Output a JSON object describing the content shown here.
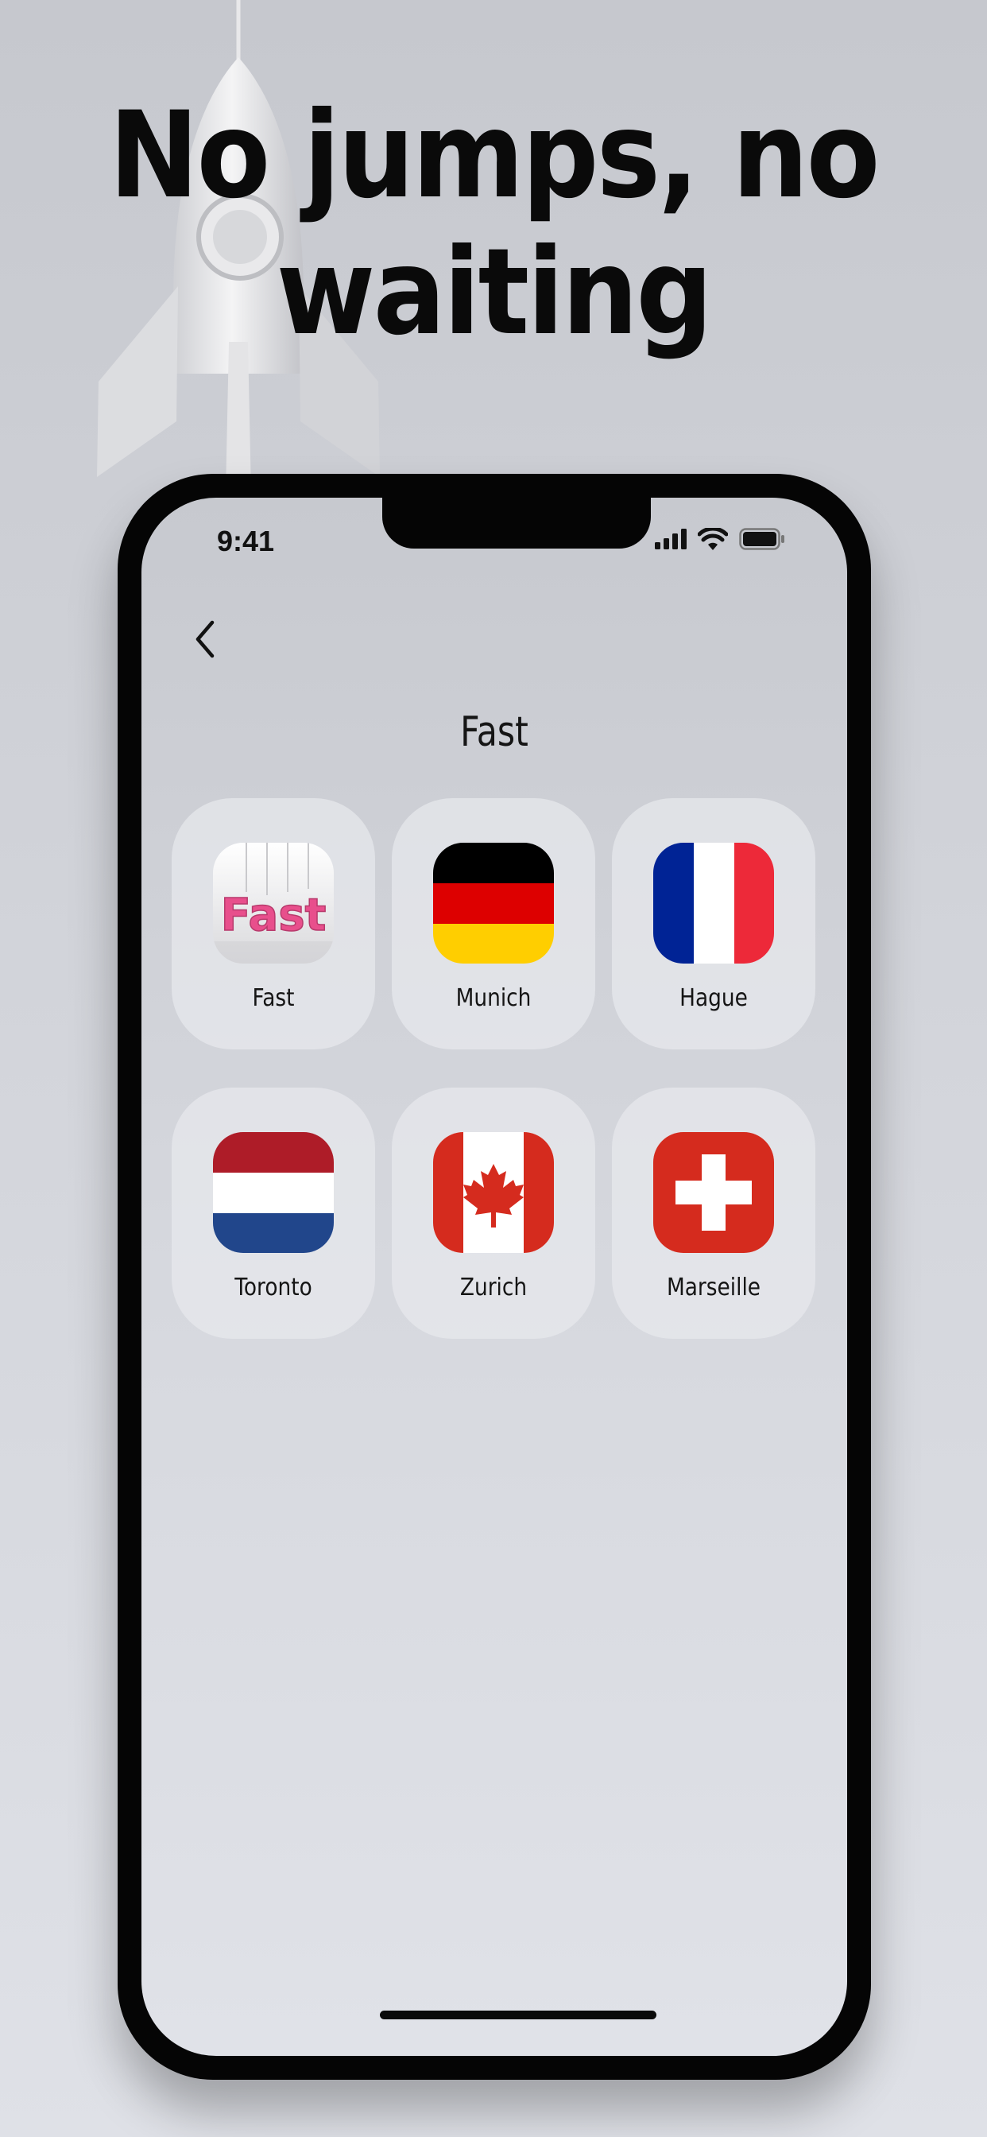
{
  "headline": {
    "line1": "No jumps, no",
    "line2": "waiting"
  },
  "status_bar": {
    "time": "9:41",
    "icons": [
      "signal-icon",
      "wifi-icon",
      "battery-icon"
    ]
  },
  "nav": {
    "back_icon": "chevron-left-icon"
  },
  "page": {
    "title": "Fast"
  },
  "locations": [
    {
      "label": "Fast",
      "icon": "fast-logo"
    },
    {
      "label": "Munich",
      "icon": "germany-flag"
    },
    {
      "label": "Hague",
      "icon": "france-flag"
    },
    {
      "label": "Toronto",
      "icon": "netherlands-flag"
    },
    {
      "label": "Zurich",
      "icon": "canada-flag"
    },
    {
      "label": "Marseille",
      "icon": "switzerland-flag"
    }
  ],
  "logo_text": "Fast",
  "colors": {
    "germany": [
      "#000000",
      "#dd0000",
      "#ffce00"
    ],
    "france": [
      "#002395",
      "#ffffff",
      "#ed2939"
    ],
    "netherlands": [
      "#ae1c28",
      "#ffffff",
      "#21468b"
    ],
    "canada": [
      "#d52b1e",
      "#ffffff"
    ],
    "switzerland": [
      "#d52b1e",
      "#ffffff"
    ]
  }
}
